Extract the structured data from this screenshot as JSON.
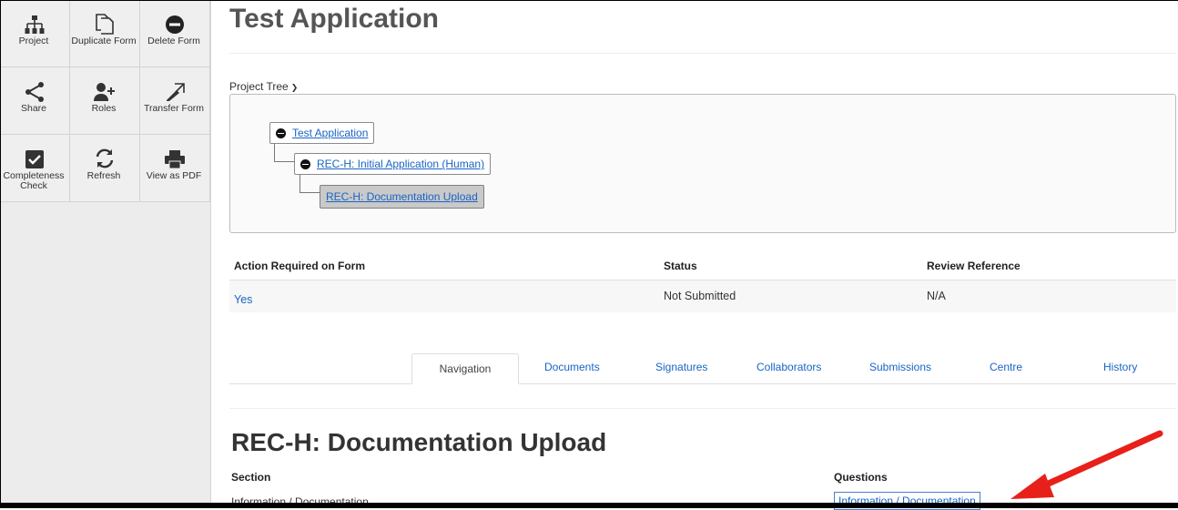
{
  "toolbar": {
    "items": [
      {
        "label": "Project",
        "icon": "project-tree-icon"
      },
      {
        "label": "Duplicate Form",
        "icon": "duplicate-icon"
      },
      {
        "label": "Delete Form",
        "icon": "delete-icon"
      },
      {
        "label": "Share",
        "icon": "share-icon"
      },
      {
        "label": "Roles",
        "icon": "add-user-icon"
      },
      {
        "label": "Transfer Form",
        "icon": "transfer-icon"
      },
      {
        "label": "Completeness Check",
        "icon": "checkbox-icon"
      },
      {
        "label": "Refresh",
        "icon": "refresh-icon"
      },
      {
        "label": "View as PDF",
        "icon": "printer-icon"
      }
    ]
  },
  "header": {
    "title": "Test Application"
  },
  "project_tree": {
    "label": "Project Tree",
    "nodes": [
      {
        "label": "Test Application"
      },
      {
        "label": "REC-H: Initial Application (Human)"
      },
      {
        "label": "REC-H: Documentation Upload"
      }
    ]
  },
  "info_table": {
    "headers": [
      "Action Required on Form",
      "Status",
      "Review Reference"
    ],
    "values": [
      "Yes",
      "Not Submitted",
      "N/A"
    ]
  },
  "tabs": [
    "Navigation",
    "Documents",
    "Signatures",
    "Collaborators",
    "Submissions",
    "Centre",
    "History"
  ],
  "form": {
    "title": "REC-H: Documentation Upload",
    "section_header": "Section",
    "questions_header": "Questions",
    "section_value": "Information / Documentation",
    "question_link": "Information / Documentation"
  },
  "colors": {
    "link": "#1a64c4",
    "annotation_arrow": "#e8201a"
  }
}
